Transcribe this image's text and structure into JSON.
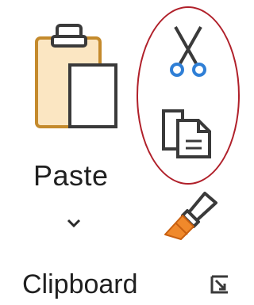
{
  "clipboard": {
    "paste_label": "Paste",
    "group_label": "Clipboard",
    "icons": {
      "paste": "clipboard-paste-icon",
      "paste_dropdown": "chevron-down-icon",
      "cut": "scissors-icon",
      "copy": "copy-icon",
      "format_painter": "paintbrush-icon",
      "launcher": "dialog-launcher-icon"
    },
    "colors": {
      "clipboard_fill": "#fbe6c2",
      "clipboard_stroke": "#c48a2c",
      "icon_dark": "#3a3a3a",
      "scissor_handles": "#2f7fd6",
      "brush_orange": "#f0892b",
      "highlight_ring": "#b0202a"
    }
  }
}
